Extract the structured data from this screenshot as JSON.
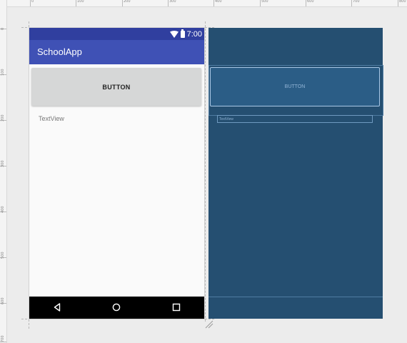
{
  "ruler": {
    "top_labels": [
      "0",
      "100",
      "200",
      "300",
      "400",
      "500",
      "600",
      "700",
      "800"
    ],
    "left_labels": [
      "0",
      "100",
      "200",
      "300",
      "400",
      "500",
      "600",
      "700"
    ]
  },
  "device": {
    "status_time": "7:00",
    "app_title": "SchoolApp",
    "button_label": "BUTTON",
    "textview_label": "TextView",
    "nav_icons": [
      "back-icon",
      "home-icon",
      "recents-icon"
    ]
  },
  "blueprint": {
    "button_label": "BUTTON",
    "textview_label": "TextView"
  },
  "colors": {
    "primary_dark": "#303f9f",
    "primary": "#3f51b5",
    "blueprint_bg": "#254f71"
  }
}
